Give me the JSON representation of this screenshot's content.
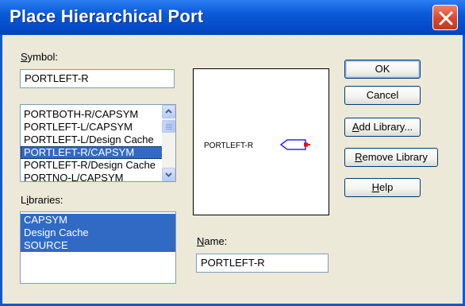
{
  "window": {
    "title": "Place Hierarchical Port"
  },
  "symbol": {
    "label_prefix": "",
    "label_mnemonic": "S",
    "label_rest": "ymbol:",
    "value": "PORTLEFT-R",
    "list": [
      {
        "label": "PORTBOTH-R/CAPSYM",
        "selected": false
      },
      {
        "label": "PORTLEFT-L/CAPSYM",
        "selected": false
      },
      {
        "label": "PORTLEFT-L/Design Cache",
        "selected": false
      },
      {
        "label": "PORTLEFT-R/CAPSYM",
        "selected": true
      },
      {
        "label": "PORTLEFT-R/Design Cache",
        "selected": false
      },
      {
        "label": "PORTNO-L/CAPSYM",
        "selected": false
      }
    ]
  },
  "libraries": {
    "label_prefix": "L",
    "label_mnemonic": "i",
    "label_rest": "braries:",
    "items": [
      {
        "label": "CAPSYM",
        "selected": true
      },
      {
        "label": "Design Cache",
        "selected": true
      },
      {
        "label": "SOURCE",
        "selected": true
      }
    ]
  },
  "preview": {
    "port_name": "PORTLEFT-R",
    "port_color": "#ff0000",
    "outline_color": "#0000ff"
  },
  "name": {
    "label_prefix": "",
    "label_mnemonic": "N",
    "label_rest": "ame:",
    "value": "PORTLEFT-R"
  },
  "buttons": {
    "ok": "OK",
    "cancel": "Cancel",
    "add_library_pre": "",
    "add_library_mn": "A",
    "add_library_rest": "dd Library...",
    "remove_library_pre": "",
    "remove_library_mn": "R",
    "remove_library_rest": "emove Library",
    "help_pre": "",
    "help_mn": "H",
    "help_rest": "elp"
  }
}
